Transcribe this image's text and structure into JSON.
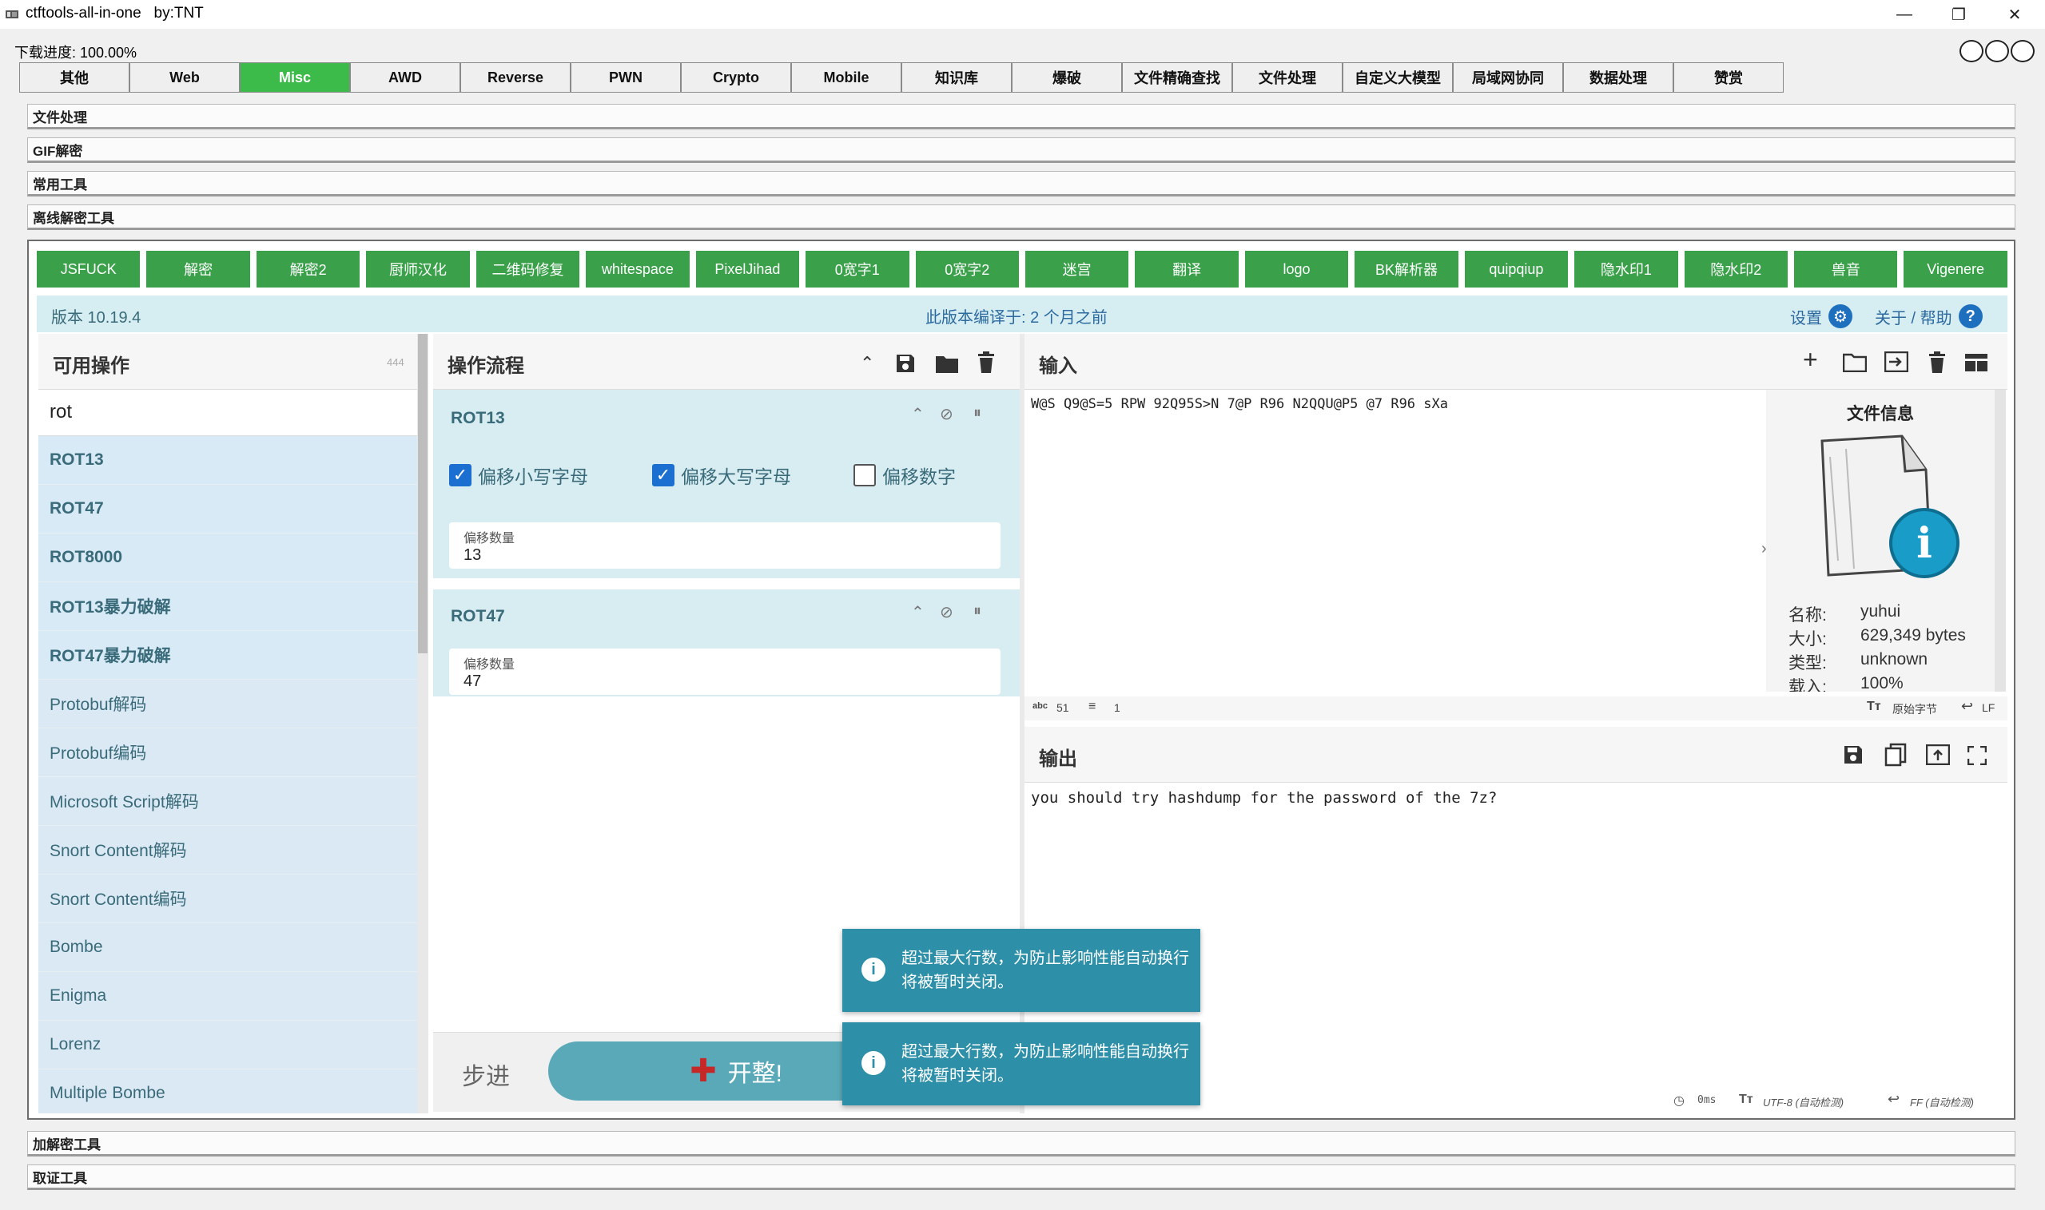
{
  "window": {
    "title": "ctftools-all-in-one   by:TNT",
    "minimize": "—",
    "maximize": "❐",
    "close": "✕"
  },
  "progress_text": "下载进度: 100.00%",
  "tabs": [
    {
      "label": "其他"
    },
    {
      "label": "Web"
    },
    {
      "label": "Misc",
      "active": true
    },
    {
      "label": "AWD"
    },
    {
      "label": "Reverse"
    },
    {
      "label": "PWN"
    },
    {
      "label": "Crypto"
    },
    {
      "label": "Mobile"
    },
    {
      "label": "知识库"
    },
    {
      "label": "爆破"
    },
    {
      "label": "文件精确查找"
    },
    {
      "label": "文件处理"
    },
    {
      "label": "自定义大模型"
    },
    {
      "label": "局域网协同"
    },
    {
      "label": "数据处理"
    },
    {
      "label": "赞赏"
    }
  ],
  "sections_top": [
    "文件处理",
    "GIF解密",
    "常用工具",
    "离线解密工具"
  ],
  "sections_bottom": [
    "加解密工具",
    "取证工具"
  ],
  "tool_buttons": [
    "JSFUCK",
    "解密",
    "解密2",
    "厨师汉化",
    "二维码修复",
    "whitespace",
    "PixelJihad",
    "0宽字1",
    "0宽字2",
    "迷宫",
    "翻译",
    "logo",
    "BK解析器",
    "quipqiup",
    "隐水印1",
    "隐水印2",
    "兽音",
    "Vigenere"
  ],
  "version_bar": {
    "version": "版本 10.19.4",
    "built": "此版本编译于:  2 个月之前",
    "settings": "设置",
    "about": "关于 / 帮助"
  },
  "operations": {
    "title": "可用操作",
    "count": "444",
    "search_value": "rot",
    "items": [
      {
        "label": "ROT13",
        "hl": true
      },
      {
        "label": "ROT47",
        "hl": true
      },
      {
        "label": "ROT8000",
        "hl": true
      },
      {
        "label": "ROT13暴力破解",
        "hl": true
      },
      {
        "label": "ROT47暴力破解",
        "hl": true
      },
      {
        "label": "Protobuf解码"
      },
      {
        "label": "Protobuf编码"
      },
      {
        "label": "Microsoft Script解码"
      },
      {
        "label": "Snort Content解码"
      },
      {
        "label": "Snort Content编码"
      },
      {
        "label": "Bombe"
      },
      {
        "label": "Enigma"
      },
      {
        "label": "Lorenz"
      },
      {
        "label": "Multiple Bombe"
      }
    ]
  },
  "recipe": {
    "title": "操作流程",
    "rot13": {
      "name": "ROT13",
      "opt_lower": "偏移小写字母",
      "opt_upper": "偏移大写字母",
      "opt_digits": "偏移数字",
      "amount_label": "偏移数量",
      "amount_value": "13"
    },
    "rot47": {
      "name": "ROT47",
      "amount_label": "偏移数量",
      "amount_value": "47"
    },
    "step_label": "步进",
    "bake_label": "开整!"
  },
  "input": {
    "title": "输入",
    "text": "W@S Q9@S=5 RPW 92Q95S>N 7@P R96 N2QQU@P5 @7 R96 sXa",
    "status_chars": "51",
    "status_lines": "1",
    "status_right": "原始字节",
    "status_eol": "LF"
  },
  "file_info": {
    "title": "文件信息",
    "name_k": "名称:",
    "name_v": "yuhui",
    "size_k": "大小:",
    "size_v": "629,349 bytes",
    "type_k": "类型:",
    "type_v": "unknown",
    "load_k": "载入:",
    "load_v": "100%"
  },
  "output": {
    "title": "输出",
    "text": "you should try hashdump for the password of the 7z?",
    "status_time": "0ms",
    "status_enc": "UTF-8 (自动检测)",
    "status_eol": "FF (自动检测)"
  },
  "toasts": [
    "超过最大行数，为防止影响性能自动换行将被暂时关闭。",
    "超过最大行数，为防止影响性能自动换行将被暂时关闭。"
  ],
  "colors": {
    "accent_green": "#3dbb4a",
    "tool_green": "#3aa14a",
    "toast": "#2e8fa8"
  }
}
